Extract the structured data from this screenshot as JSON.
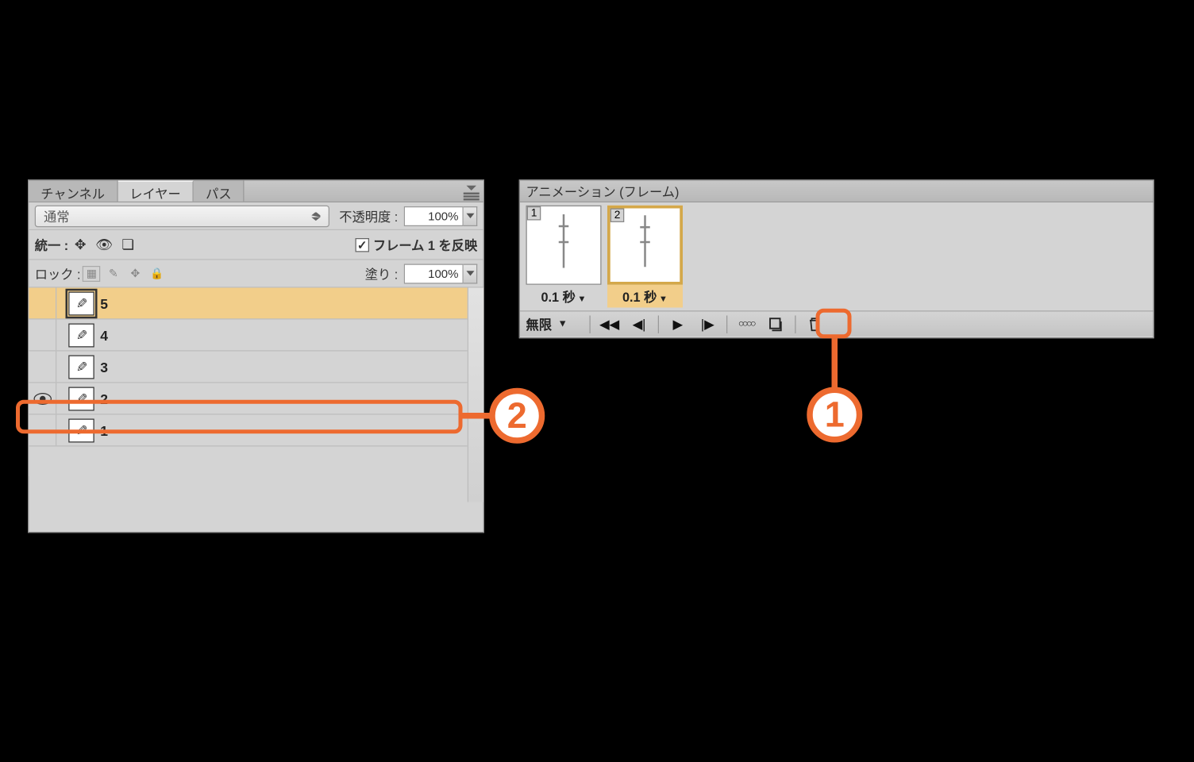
{
  "layers_panel": {
    "tabs": {
      "channels": "チャンネル",
      "layers": "レイヤー",
      "paths": "パス"
    },
    "blend_mode": "通常",
    "opacity_label": "不透明度 :",
    "opacity_value": "100%",
    "unify_label": "統一 :",
    "propagate_frame1": "フレーム 1 を反映",
    "lock_label": "ロック :",
    "fill_label": "塗り :",
    "fill_value": "100%",
    "layers": [
      {
        "name": "5",
        "visible": false,
        "selected": true
      },
      {
        "name": "4",
        "visible": false,
        "selected": false
      },
      {
        "name": "3",
        "visible": false,
        "selected": false
      },
      {
        "name": "2",
        "visible": true,
        "selected": false
      },
      {
        "name": "1",
        "visible": false,
        "selected": false
      }
    ]
  },
  "animation_panel": {
    "title": "アニメーション (フレーム)",
    "frames": [
      {
        "number": "1",
        "delay": "0.1 秒",
        "selected": false
      },
      {
        "number": "2",
        "delay": "0.1 秒",
        "selected": true
      }
    ],
    "loop": "無限"
  },
  "callouts": {
    "one": "1",
    "two": "2"
  }
}
